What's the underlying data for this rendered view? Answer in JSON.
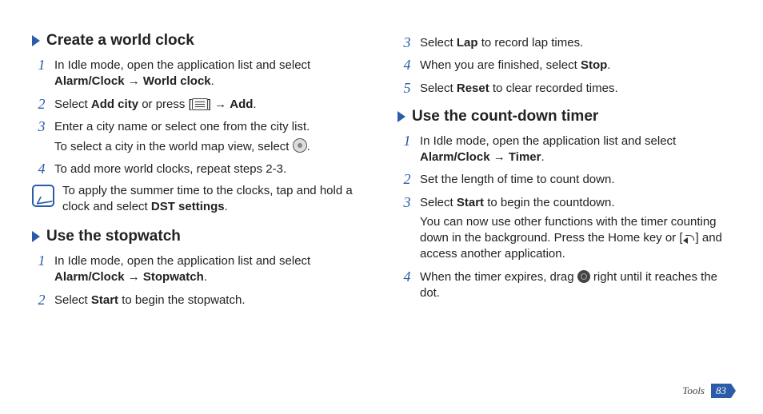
{
  "left": {
    "section1": {
      "title": "Create a world clock",
      "step1_a": "In Idle mode, open the application list and select ",
      "step1_b": "Alarm/Clock",
      "step1_c": " → ",
      "step1_d": "World clock",
      "step1_e": ".",
      "step2_a": "Select ",
      "step2_b": "Add city",
      "step2_c": " or press [",
      "step2_d": "] → ",
      "step2_e": "Add",
      "step2_f": ".",
      "step3_a": "Enter a city name or select one from the city list.",
      "step3_b": "To select a city in the world map view, select ",
      "step3_c": ".",
      "step4": "To add more world clocks, repeat steps 2-3.",
      "note_a": "To apply the summer time to the clocks, tap and hold a clock and select ",
      "note_b": "DST settings",
      "note_c": "."
    },
    "section2": {
      "title": "Use the stopwatch",
      "step1_a": "In Idle mode, open the application list and select ",
      "step1_b": "Alarm/Clock",
      "step1_c": " → ",
      "step1_d": "Stopwatch",
      "step1_e": ".",
      "step2_a": "Select ",
      "step2_b": "Start",
      "step2_c": " to begin the stopwatch."
    }
  },
  "right": {
    "cont": {
      "step3_a": "Select ",
      "step3_b": "Lap",
      "step3_c": " to record lap times.",
      "step4_a": "When you are finished, select ",
      "step4_b": "Stop",
      "step4_c": ".",
      "step5_a": "Select ",
      "step5_b": "Reset",
      "step5_c": " to clear recorded times."
    },
    "section3": {
      "title": "Use the count-down timer",
      "step1_a": "In Idle mode, open the application list and select ",
      "step1_b": "Alarm/Clock",
      "step1_c": " → ",
      "step1_d": "Timer",
      "step1_e": ".",
      "step2": "Set the length of time to count down.",
      "step3_a": "Select ",
      "step3_b": "Start",
      "step3_c": " to begin the countdown.",
      "step3_d": "You can now use other functions with the timer counting down in the background. Press the Home key or [",
      "step3_e": "] and access another application.",
      "step4_a": "When the timer expires, drag ",
      "step4_b": " right until it reaches the dot."
    }
  },
  "footer": {
    "category": "Tools",
    "page": "83"
  },
  "nums": {
    "n1": "1",
    "n2": "2",
    "n3": "3",
    "n4": "4",
    "n5": "5"
  }
}
